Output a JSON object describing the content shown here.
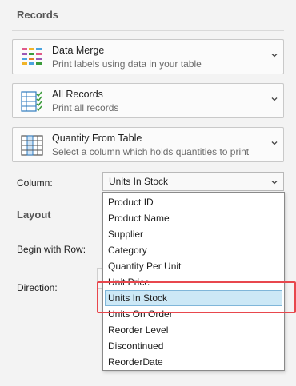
{
  "records": {
    "title": "Records",
    "cards": [
      {
        "title": "Data Merge",
        "subtitle": "Print labels using data in your table",
        "icon": "data-merge-icon"
      },
      {
        "title": "All Records",
        "subtitle": "Print all records",
        "icon": "all-records-icon"
      },
      {
        "title": "Quantity From Table",
        "subtitle": "Select a column which holds quantities to print",
        "icon": "quantity-table-icon"
      }
    ],
    "column_label": "Column:",
    "column_value": "Units In Stock"
  },
  "layout": {
    "title": "Layout",
    "begin_label": "Begin with Row:",
    "direction_label": "Direction:"
  },
  "dropdown": {
    "options": [
      "Product ID",
      "Product Name",
      "Supplier",
      "Category",
      "Quantity Per Unit",
      "Unit Price",
      "Units In Stock",
      "Units On Order",
      "Reorder Level",
      "Discontinued",
      "ReorderDate"
    ],
    "selected": "Units In Stock"
  },
  "colors": {
    "highlight": "#e8474d",
    "selection": "#cce8f6",
    "icon_blue": "#2f7bbf",
    "icon_green": "#3b9b3b"
  }
}
